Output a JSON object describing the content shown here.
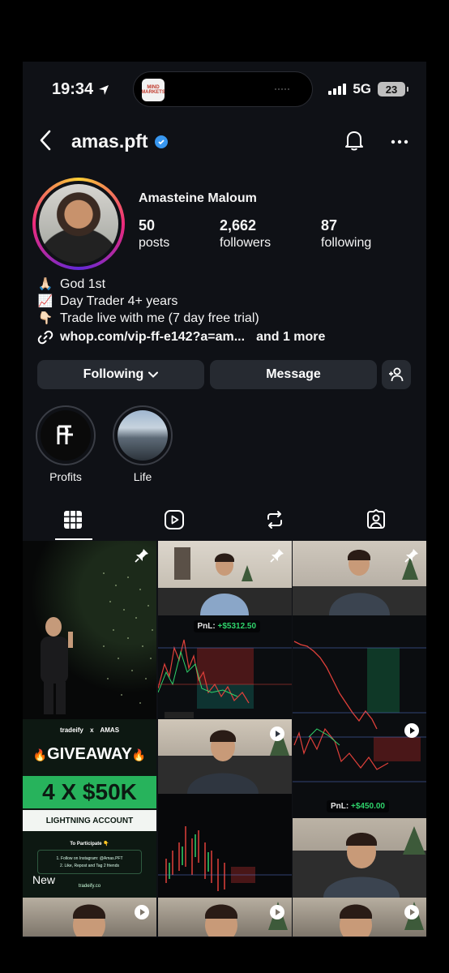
{
  "status_bar": {
    "time": "19:34",
    "network": "5G",
    "battery": "23",
    "island_app_text": "MIND MARKETS"
  },
  "header": {
    "username": "amas.pft",
    "verified": true,
    "back_icon": "chevron-left-icon",
    "bell_icon": "bell-icon",
    "more_icon": "more-horizontal-icon"
  },
  "profile": {
    "name": "Amasteine Maloum",
    "stats": [
      {
        "count": "50",
        "label": "posts"
      },
      {
        "count": "2,662",
        "label": "followers"
      },
      {
        "count": "87",
        "label": "following"
      }
    ],
    "bio": [
      {
        "emoji": "🙏🏻",
        "text": "God 1st"
      },
      {
        "emoji": "📈",
        "text": "Day Trader 4+ years"
      },
      {
        "emoji": "👇🏻",
        "text": "Trade live with me (7 day free trial)"
      }
    ],
    "link": {
      "text": "whop.com/vip-ff-e142?a=am...",
      "more": "and 1 more"
    }
  },
  "actions": {
    "following": "Following",
    "message": "Message",
    "add_user_icon": "add-person-icon"
  },
  "highlights": [
    {
      "label": "Profits"
    },
    {
      "label": "Life"
    }
  ],
  "tabs": [
    {
      "icon": "grid-icon",
      "active": true
    },
    {
      "icon": "reels-icon",
      "active": false
    },
    {
      "icon": "reposts-icon",
      "active": false
    },
    {
      "icon": "tagged-icon",
      "active": false
    }
  ],
  "posts": {
    "pnl_1": {
      "label": "PnL:",
      "value": "+$5312.50"
    },
    "pnl_2": {
      "label": "PnL:",
      "value": "+$450.00"
    },
    "giveaway": {
      "brand": "tradeify",
      "x": "x",
      "partner": "AMAS",
      "headline": "GIVEAWAY",
      "amount": "4 X $50K",
      "account": "LIGHTNING ACCOUNT",
      "participate": "To Participate 👇",
      "step1": "1. Follow on Instagram: @Amas.PFT",
      "step2": "2. Like, Repost and Tag 2 friends",
      "site": "tradeify.co"
    },
    "new_badge": "New"
  },
  "colors": {
    "background": "#0f1116",
    "button": "#262a31",
    "verified": "#3897f0",
    "profit": "#2fd36b",
    "loss": "#e0403a"
  }
}
